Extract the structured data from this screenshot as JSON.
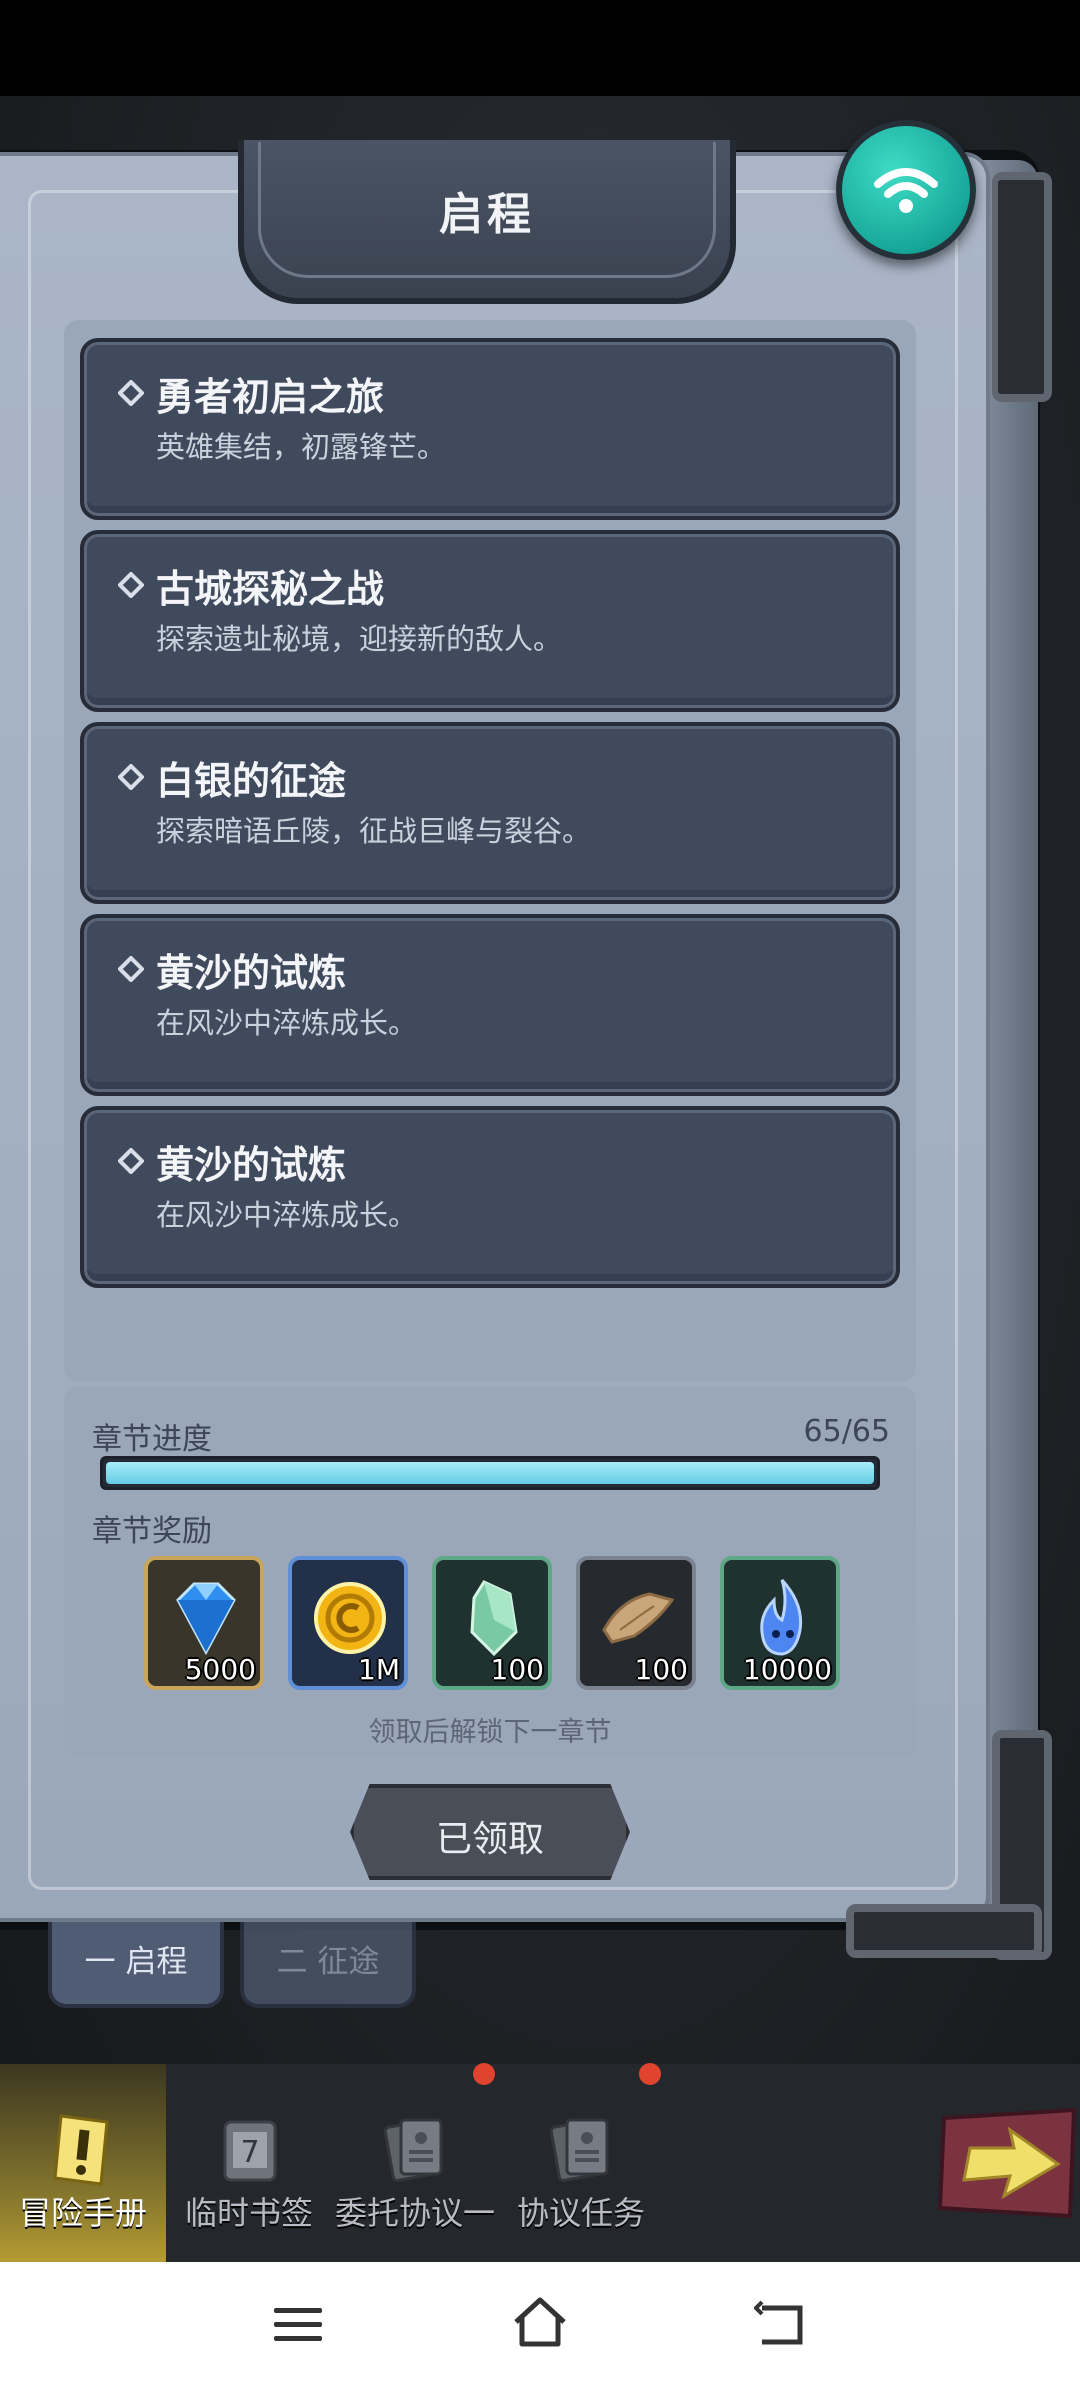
{
  "header": {
    "title": "启程"
  },
  "chapters": [
    {
      "title": "勇者初启之旅",
      "desc": "英雄集结，初露锋芒。"
    },
    {
      "title": "古城探秘之战",
      "desc": "探索遗址秘境，迎接新的敌人。"
    },
    {
      "title": "白银的征途",
      "desc": "探索暗语丘陵，征战巨峰与裂谷。"
    },
    {
      "title": "黄沙的试炼",
      "desc": "在风沙中淬炼成长。"
    },
    {
      "title": "黄沙的试炼",
      "desc": "在风沙中淬炼成长。"
    }
  ],
  "progress": {
    "label": "章节进度",
    "count": "65/65",
    "fraction": 1.0
  },
  "rewards": {
    "label": "章节奖励",
    "items": [
      {
        "icon": "diamond-icon",
        "count": "5000"
      },
      {
        "icon": "gold-coin-icon",
        "count": "1M"
      },
      {
        "icon": "green-crystal-icon",
        "count": "100"
      },
      {
        "icon": "scroll-icon",
        "count": "100"
      },
      {
        "icon": "blue-flame-icon",
        "count": "10000"
      }
    ],
    "hint": "领取后解锁下一章节"
  },
  "claim_button": {
    "label": "已领取"
  },
  "part_tabs": [
    "一 启程",
    "二 征途"
  ],
  "bottom_nav": [
    {
      "label": "冒险手册",
      "icon": "exclamation-book-icon"
    },
    {
      "label": "临时书签",
      "icon": "calendar-scroll-icon"
    },
    {
      "label": "委托协议一",
      "icon": "document-icon"
    },
    {
      "label": "协议任务",
      "icon": "document-icon"
    }
  ],
  "colors": {
    "accent": "#66cbe3",
    "badge": "#e0442e",
    "wifi": "#17a79a"
  }
}
